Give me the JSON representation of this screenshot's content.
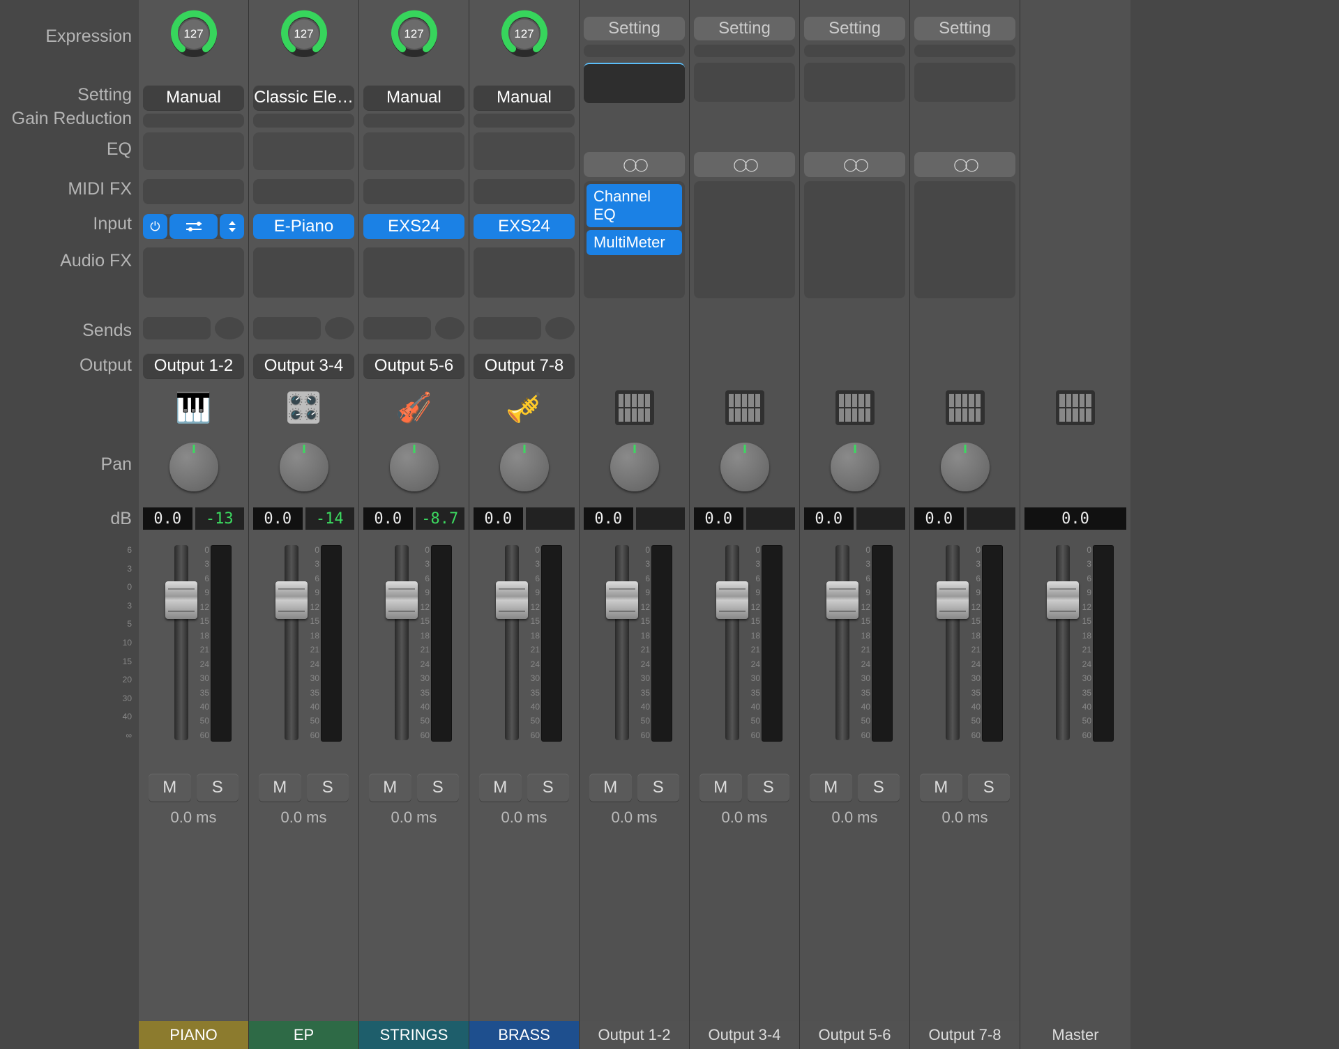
{
  "labels": {
    "expression": "Expression",
    "setting": "Setting",
    "gain_reduction": "Gain Reduction",
    "eq": "EQ",
    "midi_fx": "MIDI FX",
    "input": "Input",
    "audio_fx": "Audio FX",
    "sends": "Sends",
    "output": "Output",
    "pan": "Pan",
    "db": "dB"
  },
  "fader_scale_left": [
    "6",
    "3",
    "0",
    "3",
    "5",
    "10",
    "15",
    "20",
    "30",
    "40",
    "∞"
  ],
  "meter_scale": [
    "0",
    "3",
    "6",
    "9",
    "12",
    "15",
    "18",
    "21",
    "24",
    "30",
    "35",
    "40",
    "50",
    "60"
  ],
  "ms": {
    "mute": "M",
    "solo": "S"
  },
  "expr_max": "127",
  "strips": [
    {
      "kind": "inst",
      "setting": "Manual",
      "input": "",
      "input_mode": "powerbar",
      "output": "Output 1-2",
      "icon": "🎹",
      "db_l": "0.0",
      "db_r": "-13",
      "latency": "0.0 ms",
      "name": "PIANO",
      "color": "c-piano"
    },
    {
      "kind": "inst",
      "setting": "Classic Ele…",
      "input": "E-Piano",
      "input_mode": "blue",
      "output": "Output 3-4",
      "icon": "🎛️",
      "db_l": "0.0",
      "db_r": "-14",
      "latency": "0.0 ms",
      "name": "EP",
      "color": "c-ep"
    },
    {
      "kind": "inst",
      "setting": "Manual",
      "input": "EXS24",
      "input_mode": "blue",
      "output": "Output 5-6",
      "icon": "🎻",
      "db_l": "0.0",
      "db_r": "-8.7",
      "latency": "0.0 ms",
      "name": "STRINGS",
      "color": "c-str"
    },
    {
      "kind": "inst",
      "setting": "Manual",
      "input": "EXS24",
      "input_mode": "blue",
      "output": "Output 7-8",
      "icon": "🎺",
      "db_l": "0.0",
      "db_r": "",
      "latency": "0.0 ms",
      "name": "BRASS",
      "color": "c-brass"
    },
    {
      "kind": "bus",
      "bus_setting": "Setting",
      "eq_active": true,
      "plugins": [
        "Channel EQ",
        "MultiMeter"
      ],
      "db_l": "0.0",
      "db_r": "",
      "latency": "0.0 ms",
      "name": "Output 1-2",
      "color": "c-out"
    },
    {
      "kind": "bus",
      "bus_setting": "Setting",
      "eq_active": false,
      "plugins": [],
      "db_l": "0.0",
      "db_r": "",
      "latency": "0.0 ms",
      "name": "Output 3-4",
      "color": "c-out"
    },
    {
      "kind": "bus",
      "bus_setting": "Setting",
      "eq_active": false,
      "plugins": [],
      "db_l": "0.0",
      "db_r": "",
      "latency": "0.0 ms",
      "name": "Output 5-6",
      "color": "c-out"
    },
    {
      "kind": "bus",
      "bus_setting": "Setting",
      "eq_active": false,
      "plugins": [],
      "db_l": "0.0",
      "db_r": "",
      "latency": "0.0 ms",
      "name": "Output 7-8",
      "color": "c-out"
    },
    {
      "kind": "master",
      "db_l": "0.0",
      "name": "Master",
      "color": "c-master"
    }
  ]
}
